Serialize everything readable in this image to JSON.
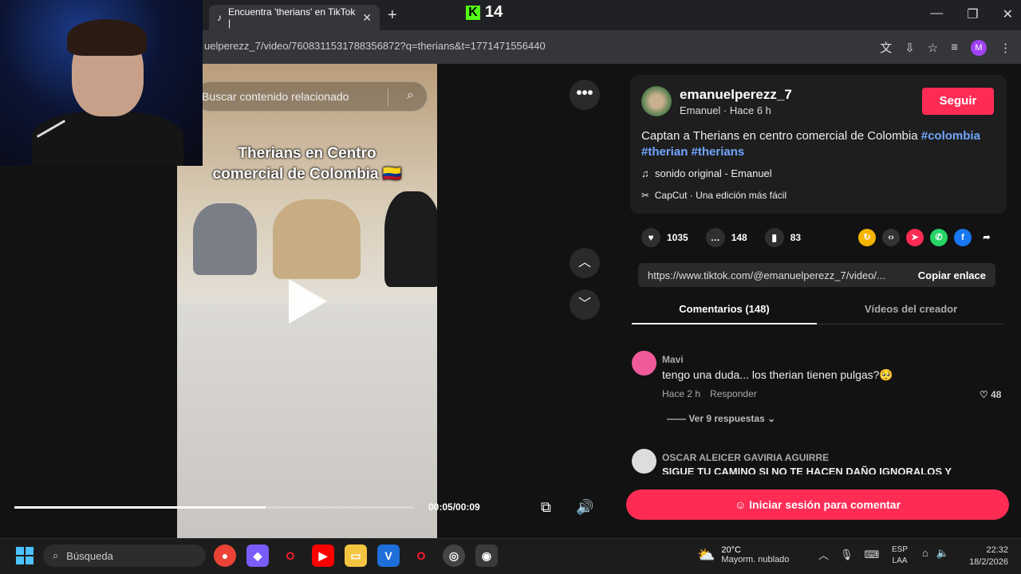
{
  "browser": {
    "tab_title": "Encuentra 'therians' en TikTok |",
    "tab_icon": "tiktok-icon",
    "new_tab_label": "+",
    "kick_badge": "14",
    "url": "uelperezz_7/video/7608311531788356872?q=therians&t=1771471556440",
    "profile_initial": "M"
  },
  "video": {
    "search_placeholder": "Buscar contenido relacionado",
    "caption_line1": "Therians en Centro",
    "caption_line2": "comercial de Colombia",
    "time": "00:05/00:09",
    "progress": 0.63
  },
  "post": {
    "author_handle": "emanuelperezz_7",
    "author_sub": "Emanuel · Hace 6 h",
    "follow_label": "Seguir",
    "description": "Captan a Therians en centro comercial de Colombia",
    "hashtags": [
      "#colombia",
      "#therian",
      "#therians"
    ],
    "sound": "sonido original - Emanuel",
    "capcut": "CapCut · Una edición más fácil",
    "likes": "1035",
    "comments": "148",
    "saves": "83",
    "link": "https://www.tiktok.com/@emanuelperezz_7/video/...",
    "copy_label": "Copiar enlace"
  },
  "tabs": {
    "comments": "Comentarios (148)",
    "creator": "Vídeos del creador"
  },
  "comments": [
    {
      "name": "Mavi",
      "text": "tengo una duda... los therian tienen pulgas?🥺",
      "time": "Hace 2 h",
      "reply": "Responder",
      "likes": "48",
      "replies": "Ver 9 respuestas"
    },
    {
      "name": "OSCAR ALEICER GAVIRIA AGUIRRE",
      "text": "SIGUE TU CAMINO SI NO TE HACEN DAÑO IGNORALOS Y"
    }
  ],
  "login_label": "Iniciar sesión para comentar",
  "taskbar": {
    "search": "Búsqueda",
    "temp": "20°C",
    "weather": "Mayorm. nublado",
    "lang1": "ESP",
    "lang2": "LAA",
    "time": "22:32",
    "date": "18/2/2026"
  }
}
